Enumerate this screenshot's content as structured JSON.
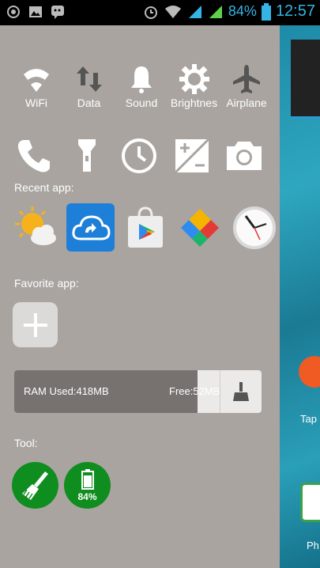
{
  "status_bar": {
    "battery_percent": "84%",
    "time": "12:57",
    "icons": [
      "circle-icon",
      "image-icon",
      "bbm-icon",
      "alarm-icon",
      "wifi-icon",
      "signal-icon",
      "signal-icon",
      "battery-icon"
    ],
    "accent_color": "#34b5e5"
  },
  "quick_toggles": [
    {
      "label": "WiFi",
      "icon": "wifi-icon"
    },
    {
      "label": "Data",
      "icon": "data-arrows-icon"
    },
    {
      "label": "Sound",
      "icon": "bell-icon"
    },
    {
      "label": "Brightnes",
      "icon": "sun-gear-icon"
    },
    {
      "label": "Airplane",
      "icon": "airplane-icon"
    }
  ],
  "quick_tools": [
    "phone-icon",
    "flashlight-icon",
    "clock-icon",
    "calculator-icon",
    "camera-icon"
  ],
  "recent_apps": {
    "label": "Recent app:",
    "apps": [
      "weather-icon",
      "cloud-sync-icon",
      "play-store-icon",
      "google-wallet-icon",
      "clock-app-icon"
    ]
  },
  "favorite_apps": {
    "label": "Favorite app:",
    "add_icon": "plus-icon"
  },
  "ram": {
    "used_label": "RAM Used:418MB",
    "free_label": "Free:52MB",
    "used_fraction": 0.74,
    "clean_icon": "broom-icon"
  },
  "tools": {
    "label": "Tool:",
    "items": [
      {
        "icon": "broom-icon",
        "text": ""
      },
      {
        "icon": "battery-icon",
        "text": "84%"
      }
    ],
    "color": "#0f8d1f"
  },
  "home_screen": {
    "label1": "Tap",
    "label2": "Ph"
  }
}
